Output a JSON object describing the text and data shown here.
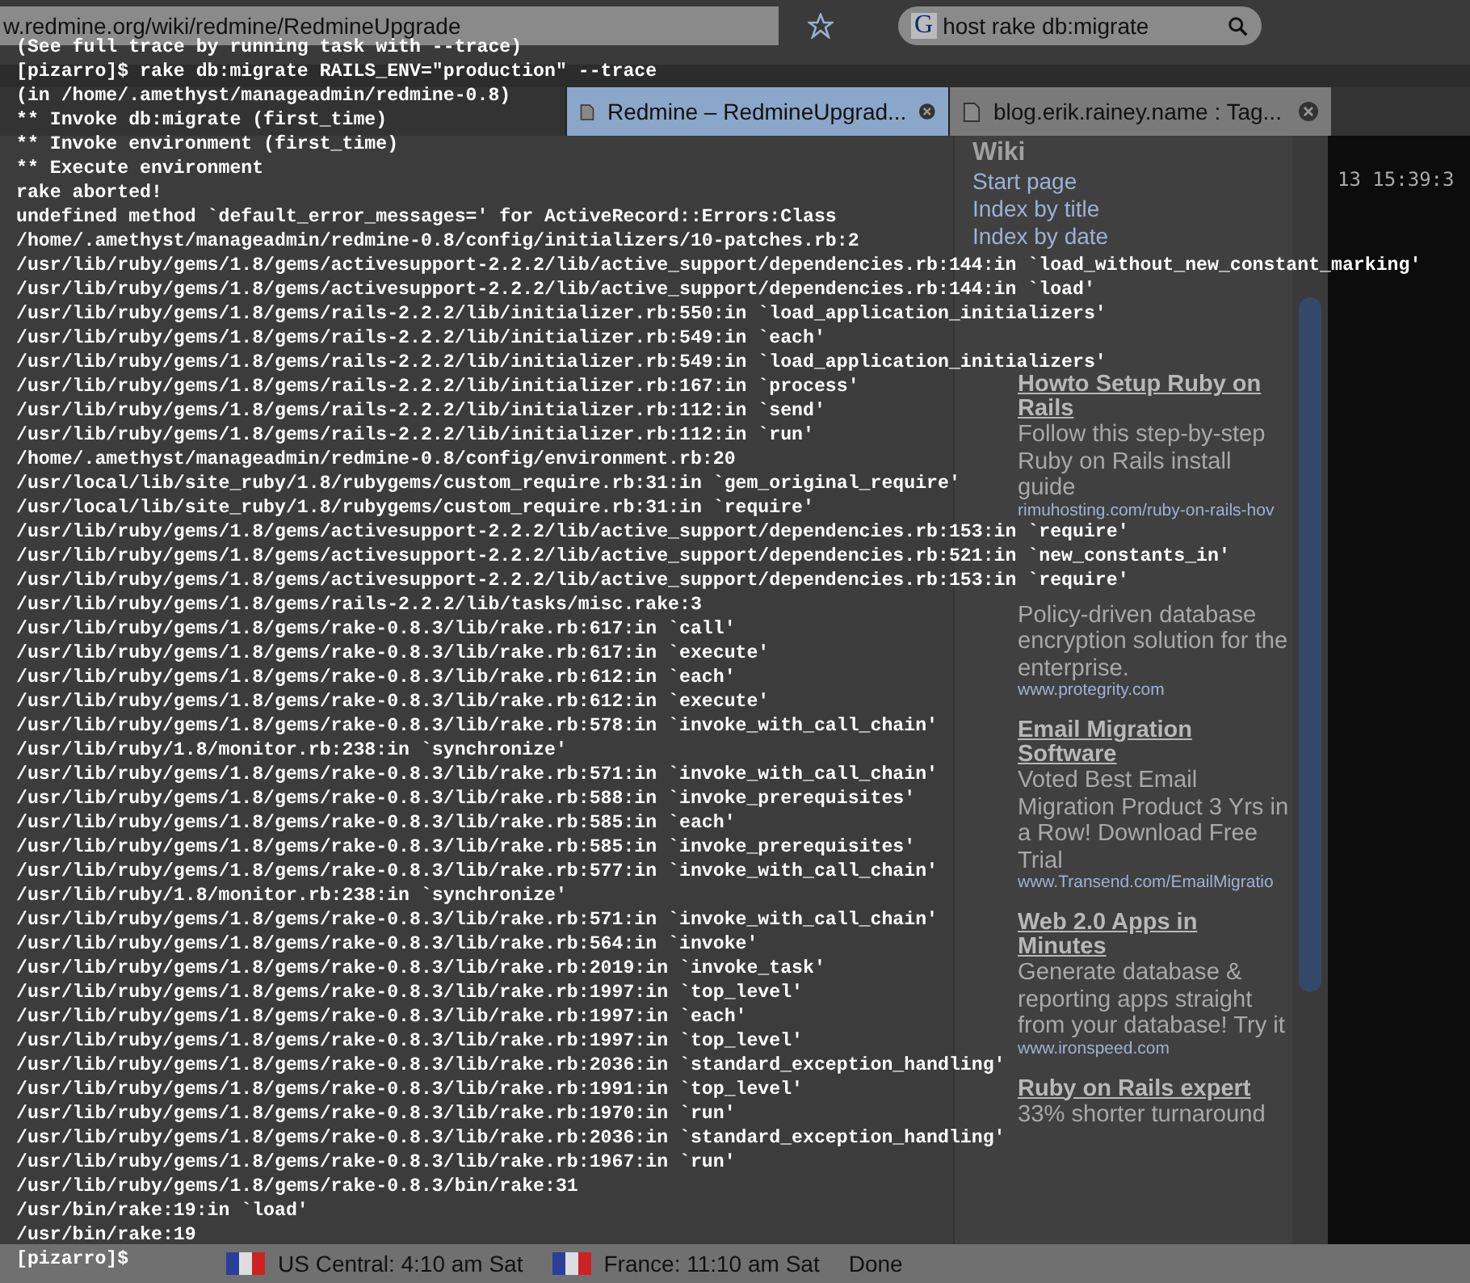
{
  "browser": {
    "url": "w.redmine.org/wiki/redmine/RedmineUpgrade",
    "search": {
      "engine_icon": "G",
      "value": "host rake db:migrate"
    },
    "tabs": [
      {
        "label": "Redmine – RedmineUpgrad...",
        "selected": true
      },
      {
        "label": "blog.erik.rainey.name : Tag...",
        "selected": false
      }
    ],
    "sidebar": {
      "heading": "Wiki",
      "links": [
        "Start page",
        "Index by title",
        "Index by date"
      ],
      "ads": [
        {
          "title": "Howto Setup Ruby on Rails",
          "body": "Follow this step-by-step Ruby on Rails install guide",
          "url": "rimuhosting.com/ruby-on-rails-hov"
        },
        {
          "body": "Policy-driven database encryption solution for the enterprise.",
          "url": "www.protegrity.com"
        },
        {
          "title": "Email Migration Software",
          "body": "Voted Best Email Migration Product 3 Yrs in a Row! Download Free Trial",
          "url": "www.Transend.com/EmailMigratio"
        },
        {
          "title": "Web 2.0 Apps in Minutes",
          "body": "Generate database & reporting apps straight from your database! Try it",
          "url": "www.ironspeed.com"
        },
        {
          "title": "Ruby on Rails expert",
          "body": "33% shorter turnaround"
        }
      ]
    },
    "clock": "13 15:39:3",
    "status_bar": {
      "clocks": [
        {
          "label": "US Central: 4:10 am Sat"
        },
        {
          "label": "France: 11:10 am Sat"
        }
      ],
      "status": "Done"
    }
  },
  "terminal": {
    "lines": [
      "(See full trace by running task with --trace)",
      "[pizarro]$ rake db:migrate RAILS_ENV=\"production\" --trace",
      "(in /home/.amethyst/manageadmin/redmine-0.8)",
      "** Invoke db:migrate (first_time)",
      "** Invoke environment (first_time)",
      "** Execute environment",
      "rake aborted!",
      "undefined method `default_error_messages=' for ActiveRecord::Errors:Class",
      "/home/.amethyst/manageadmin/redmine-0.8/config/initializers/10-patches.rb:2",
      "/usr/lib/ruby/gems/1.8/gems/activesupport-2.2.2/lib/active_support/dependencies.rb:144:in `load_without_new_constant_marking'",
      "/usr/lib/ruby/gems/1.8/gems/activesupport-2.2.2/lib/active_support/dependencies.rb:144:in `load'",
      "/usr/lib/ruby/gems/1.8/gems/rails-2.2.2/lib/initializer.rb:550:in `load_application_initializers'",
      "/usr/lib/ruby/gems/1.8/gems/rails-2.2.2/lib/initializer.rb:549:in `each'",
      "/usr/lib/ruby/gems/1.8/gems/rails-2.2.2/lib/initializer.rb:549:in `load_application_initializers'",
      "/usr/lib/ruby/gems/1.8/gems/rails-2.2.2/lib/initializer.rb:167:in `process'",
      "/usr/lib/ruby/gems/1.8/gems/rails-2.2.2/lib/initializer.rb:112:in `send'",
      "/usr/lib/ruby/gems/1.8/gems/rails-2.2.2/lib/initializer.rb:112:in `run'",
      "/home/.amethyst/manageadmin/redmine-0.8/config/environment.rb:20",
      "/usr/local/lib/site_ruby/1.8/rubygems/custom_require.rb:31:in `gem_original_require'",
      "/usr/local/lib/site_ruby/1.8/rubygems/custom_require.rb:31:in `require'",
      "/usr/lib/ruby/gems/1.8/gems/activesupport-2.2.2/lib/active_support/dependencies.rb:153:in `require'",
      "/usr/lib/ruby/gems/1.8/gems/activesupport-2.2.2/lib/active_support/dependencies.rb:521:in `new_constants_in'",
      "/usr/lib/ruby/gems/1.8/gems/activesupport-2.2.2/lib/active_support/dependencies.rb:153:in `require'",
      "/usr/lib/ruby/gems/1.8/gems/rails-2.2.2/lib/tasks/misc.rake:3",
      "/usr/lib/ruby/gems/1.8/gems/rake-0.8.3/lib/rake.rb:617:in `call'",
      "/usr/lib/ruby/gems/1.8/gems/rake-0.8.3/lib/rake.rb:617:in `execute'",
      "/usr/lib/ruby/gems/1.8/gems/rake-0.8.3/lib/rake.rb:612:in `each'",
      "/usr/lib/ruby/gems/1.8/gems/rake-0.8.3/lib/rake.rb:612:in `execute'",
      "/usr/lib/ruby/gems/1.8/gems/rake-0.8.3/lib/rake.rb:578:in `invoke_with_call_chain'",
      "/usr/lib/ruby/1.8/monitor.rb:238:in `synchronize'",
      "/usr/lib/ruby/gems/1.8/gems/rake-0.8.3/lib/rake.rb:571:in `invoke_with_call_chain'",
      "/usr/lib/ruby/gems/1.8/gems/rake-0.8.3/lib/rake.rb:588:in `invoke_prerequisites'",
      "/usr/lib/ruby/gems/1.8/gems/rake-0.8.3/lib/rake.rb:585:in `each'",
      "/usr/lib/ruby/gems/1.8/gems/rake-0.8.3/lib/rake.rb:585:in `invoke_prerequisites'",
      "/usr/lib/ruby/gems/1.8/gems/rake-0.8.3/lib/rake.rb:577:in `invoke_with_call_chain'",
      "/usr/lib/ruby/1.8/monitor.rb:238:in `synchronize'",
      "/usr/lib/ruby/gems/1.8/gems/rake-0.8.3/lib/rake.rb:571:in `invoke_with_call_chain'",
      "/usr/lib/ruby/gems/1.8/gems/rake-0.8.3/lib/rake.rb:564:in `invoke'",
      "/usr/lib/ruby/gems/1.8/gems/rake-0.8.3/lib/rake.rb:2019:in `invoke_task'",
      "/usr/lib/ruby/gems/1.8/gems/rake-0.8.3/lib/rake.rb:1997:in `top_level'",
      "/usr/lib/ruby/gems/1.8/gems/rake-0.8.3/lib/rake.rb:1997:in `each'",
      "/usr/lib/ruby/gems/1.8/gems/rake-0.8.3/lib/rake.rb:1997:in `top_level'",
      "/usr/lib/ruby/gems/1.8/gems/rake-0.8.3/lib/rake.rb:2036:in `standard_exception_handling'",
      "/usr/lib/ruby/gems/1.8/gems/rake-0.8.3/lib/rake.rb:1991:in `top_level'",
      "/usr/lib/ruby/gems/1.8/gems/rake-0.8.3/lib/rake.rb:1970:in `run'",
      "/usr/lib/ruby/gems/1.8/gems/rake-0.8.3/lib/rake.rb:2036:in `standard_exception_handling'",
      "/usr/lib/ruby/gems/1.8/gems/rake-0.8.3/lib/rake.rb:1967:in `run'",
      "/usr/lib/ruby/gems/1.8/gems/rake-0.8.3/bin/rake:31",
      "/usr/bin/rake:19:in `load'",
      "/usr/bin/rake:19",
      "[pizarro]$"
    ]
  }
}
